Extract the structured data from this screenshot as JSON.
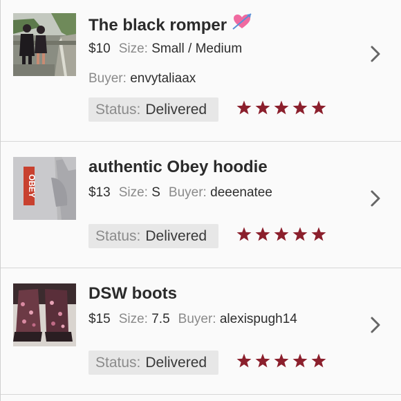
{
  "accent_color": "#8b1f2c",
  "items": [
    {
      "title": "The black romper",
      "title_emoji": "heart-with-arrow",
      "price": "$10",
      "size_label": "Size:",
      "size": "Small / Medium",
      "buyer_label": "Buyer:",
      "buyer": "envytaliaax",
      "status_label": "Status:",
      "status": "Delivered",
      "rating": 5,
      "thumbnail_icon": "photo-two-people-outdoors"
    },
    {
      "title": "authentic Obey hoodie",
      "price": "$13",
      "size_label": "Size:",
      "size": "S",
      "buyer_label": "Buyer:",
      "buyer": "deeenatee",
      "status_label": "Status:",
      "status": "Delivered",
      "rating": 5,
      "thumbnail_icon": "photo-grey-hoodie",
      "thumbnail_text": "OBEY"
    },
    {
      "title": "DSW boots",
      "price": "$15",
      "size_label": "Size:",
      "size": "7.5",
      "buyer_label": "Buyer:",
      "buyer": "alexispugh14",
      "status_label": "Status:",
      "status": "Delivered",
      "rating": 5,
      "thumbnail_icon": "photo-floral-boots"
    }
  ]
}
